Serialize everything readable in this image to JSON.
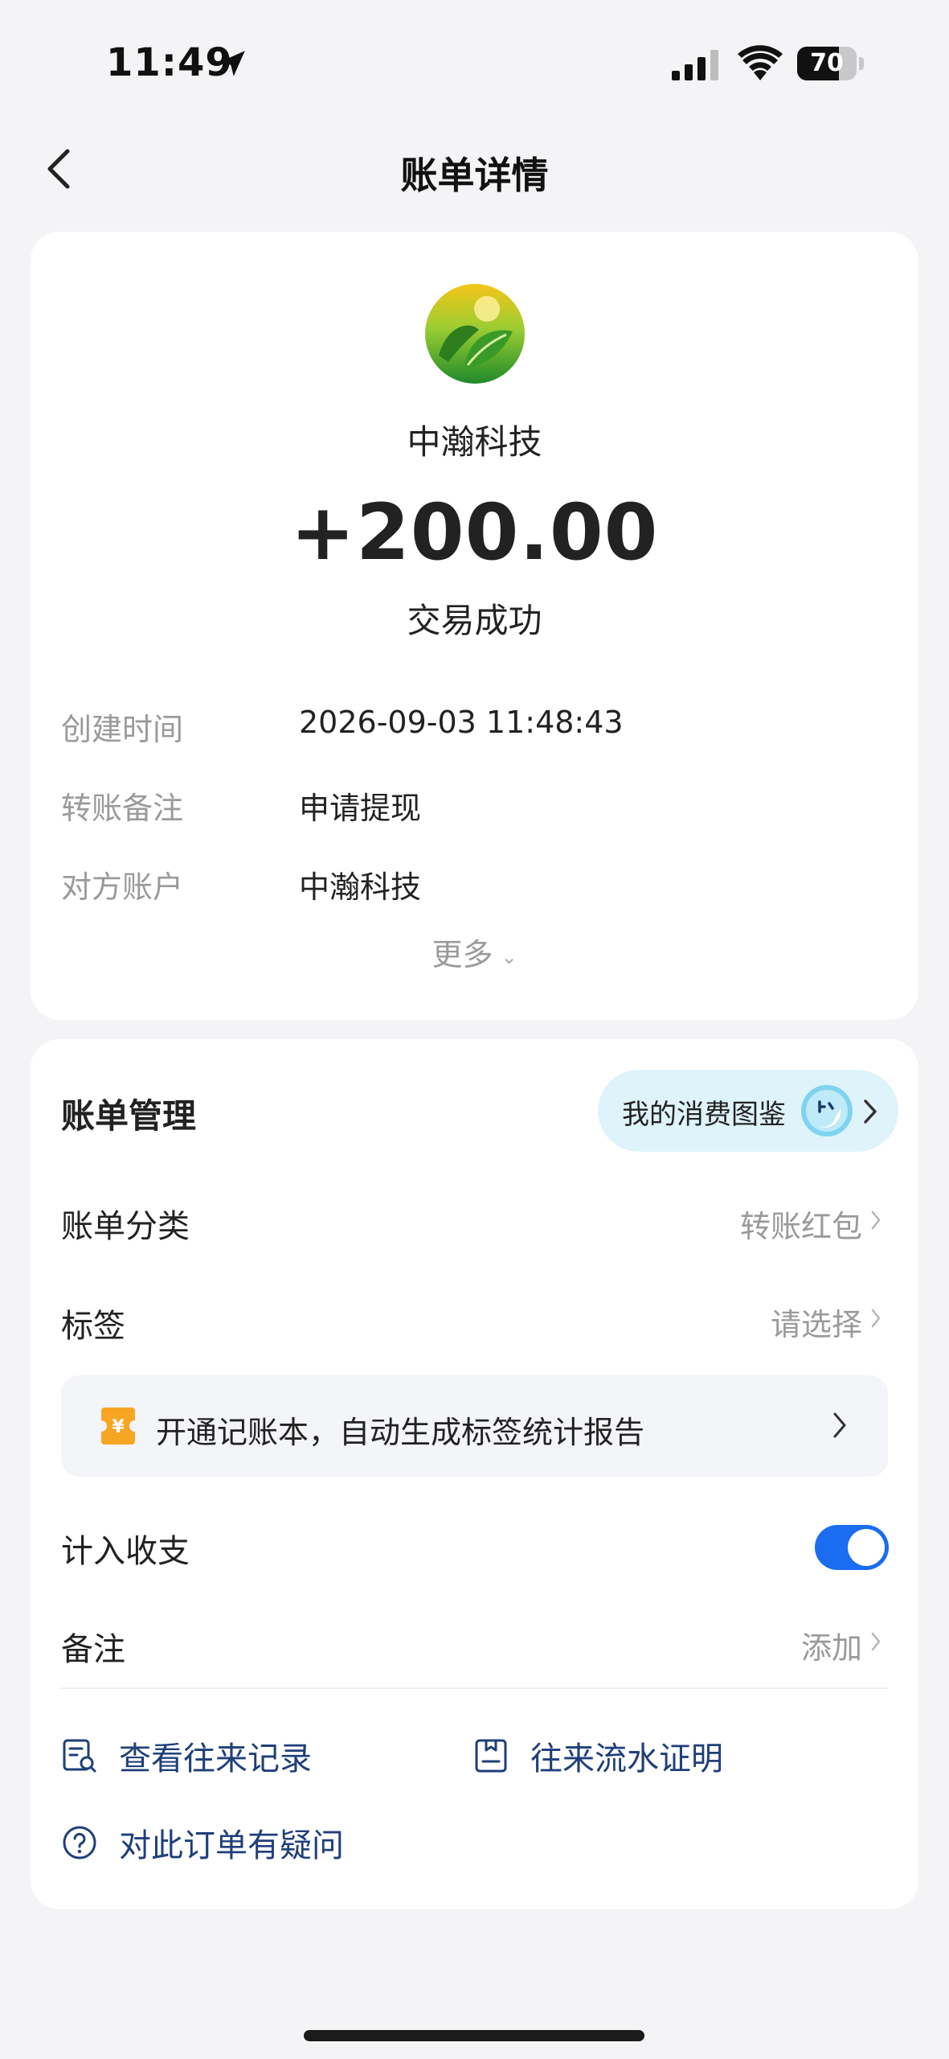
{
  "status_bar": {
    "time": "11:49",
    "battery": 70
  },
  "nav": {
    "title": "账单详情"
  },
  "transaction": {
    "merchant": "中瀚科技",
    "amount": "+200.00",
    "status": "交易成功",
    "details": [
      {
        "label": "创建时间",
        "value": "2026-09-03 11:48:43"
      },
      {
        "label": "转账备注",
        "value": "申请提现"
      },
      {
        "label": "对方账户",
        "value": "中瀚科技"
      }
    ],
    "more_label": "更多"
  },
  "management": {
    "title": "账单管理",
    "pill_label": "我的消费图鉴",
    "category_label": "账单分类",
    "category_value": "转账红包",
    "tag_label": "标签",
    "tag_value": "请选择",
    "promo_text": "开通记账本，自动生成标签统计报告",
    "include_label": "计入收支",
    "include_enabled": true,
    "note_label": "备注",
    "note_value": "添加"
  },
  "links": {
    "records": "查看往来记录",
    "proof": "往来流水证明",
    "question": "对此订单有疑问"
  }
}
